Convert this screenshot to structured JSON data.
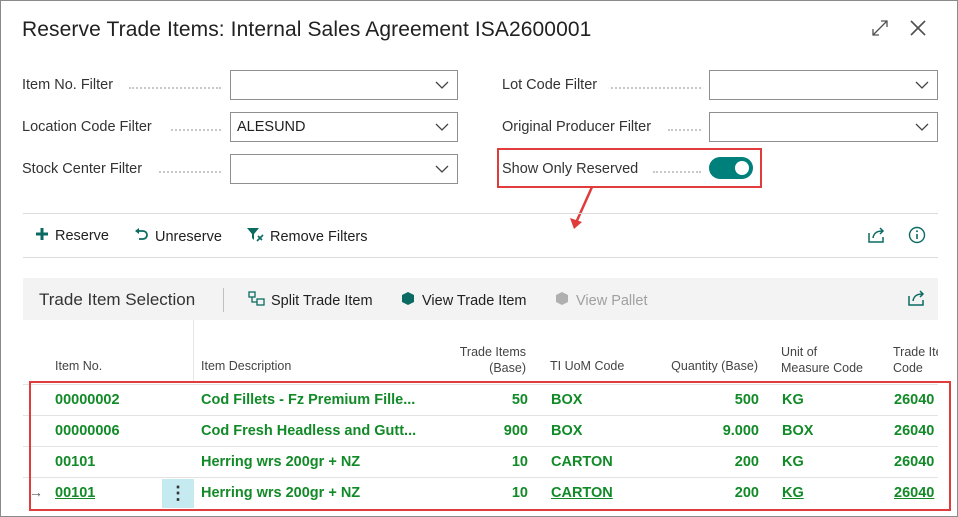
{
  "dialog": {
    "title": "Reserve Trade Items: Internal Sales Agreement ISA2600001"
  },
  "filters": {
    "item_no": {
      "label": "Item No. Filter",
      "value": ""
    },
    "location_code": {
      "label": "Location Code Filter",
      "value": "ALESUND"
    },
    "stock_center": {
      "label": "Stock Center Filter",
      "value": ""
    },
    "lot_code": {
      "label": "Lot Code Filter",
      "value": ""
    },
    "original_producer": {
      "label": "Original Producer Filter",
      "value": ""
    },
    "show_only_reserved": {
      "label": "Show Only Reserved",
      "on": true
    }
  },
  "actions": {
    "reserve": "Reserve",
    "unreserve": "Unreserve",
    "remove_filters": "Remove Filters"
  },
  "subpage": {
    "title": "Trade Item Selection",
    "split": "Split Trade Item",
    "view_trade_item": "View Trade Item",
    "view_pallet": "View Pallet"
  },
  "columns": {
    "item_no": "Item No.",
    "item_desc": "Item Description",
    "trade_items_1": "Trade Items",
    "trade_items_2": "(Base)",
    "ti_uom": "TI UoM Code",
    "qty": "Quantity (Base)",
    "uom_1": "Unit of",
    "uom_2": "Measure Code",
    "trade_item_code_1": "Trade Ite",
    "trade_item_code_2": "Code"
  },
  "rows": [
    {
      "item_no": "00000002",
      "desc": "Cod Fillets - Fz Premium Fille...",
      "trade_items": "50",
      "ti_uom": "BOX",
      "qty": "500",
      "uom": "KG",
      "code": "26040"
    },
    {
      "item_no": "00000006",
      "desc": "Cod Fresh Headless and Gutt...",
      "trade_items": "900",
      "ti_uom": "BOX",
      "qty": "9.000",
      "uom": "BOX",
      "code": "26040"
    },
    {
      "item_no": "00101",
      "desc": "Herring wrs 200gr + NZ",
      "trade_items": "10",
      "ti_uom": "CARTON",
      "qty": "200",
      "uom": "KG",
      "code": "26040"
    },
    {
      "item_no": "00101",
      "desc": "Herring wrs 200gr + NZ",
      "trade_items": "10",
      "ti_uom": "CARTON",
      "qty": "200",
      "uom": "KG",
      "code": "26040"
    }
  ],
  "colors": {
    "accent": "#00807a",
    "link_green": "#118a27",
    "highlight_red": "#e03c3c",
    "selected_cell": "#c5eaf0"
  }
}
